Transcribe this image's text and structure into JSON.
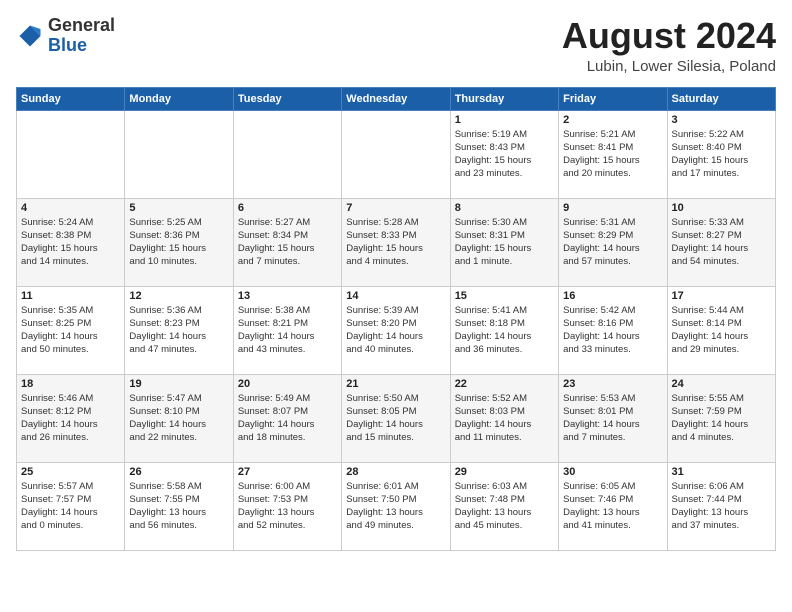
{
  "header": {
    "logo_general": "General",
    "logo_blue": "Blue",
    "month_title": "August 2024",
    "location": "Lubin, Lower Silesia, Poland"
  },
  "weekdays": [
    "Sunday",
    "Monday",
    "Tuesday",
    "Wednesday",
    "Thursday",
    "Friday",
    "Saturday"
  ],
  "weeks": [
    [
      {
        "day": "",
        "info": ""
      },
      {
        "day": "",
        "info": ""
      },
      {
        "day": "",
        "info": ""
      },
      {
        "day": "",
        "info": ""
      },
      {
        "day": "1",
        "info": "Sunrise: 5:19 AM\nSunset: 8:43 PM\nDaylight: 15 hours\nand 23 minutes."
      },
      {
        "day": "2",
        "info": "Sunrise: 5:21 AM\nSunset: 8:41 PM\nDaylight: 15 hours\nand 20 minutes."
      },
      {
        "day": "3",
        "info": "Sunrise: 5:22 AM\nSunset: 8:40 PM\nDaylight: 15 hours\nand 17 minutes."
      }
    ],
    [
      {
        "day": "4",
        "info": "Sunrise: 5:24 AM\nSunset: 8:38 PM\nDaylight: 15 hours\nand 14 minutes."
      },
      {
        "day": "5",
        "info": "Sunrise: 5:25 AM\nSunset: 8:36 PM\nDaylight: 15 hours\nand 10 minutes."
      },
      {
        "day": "6",
        "info": "Sunrise: 5:27 AM\nSunset: 8:34 PM\nDaylight: 15 hours\nand 7 minutes."
      },
      {
        "day": "7",
        "info": "Sunrise: 5:28 AM\nSunset: 8:33 PM\nDaylight: 15 hours\nand 4 minutes."
      },
      {
        "day": "8",
        "info": "Sunrise: 5:30 AM\nSunset: 8:31 PM\nDaylight: 15 hours\nand 1 minute."
      },
      {
        "day": "9",
        "info": "Sunrise: 5:31 AM\nSunset: 8:29 PM\nDaylight: 14 hours\nand 57 minutes."
      },
      {
        "day": "10",
        "info": "Sunrise: 5:33 AM\nSunset: 8:27 PM\nDaylight: 14 hours\nand 54 minutes."
      }
    ],
    [
      {
        "day": "11",
        "info": "Sunrise: 5:35 AM\nSunset: 8:25 PM\nDaylight: 14 hours\nand 50 minutes."
      },
      {
        "day": "12",
        "info": "Sunrise: 5:36 AM\nSunset: 8:23 PM\nDaylight: 14 hours\nand 47 minutes."
      },
      {
        "day": "13",
        "info": "Sunrise: 5:38 AM\nSunset: 8:21 PM\nDaylight: 14 hours\nand 43 minutes."
      },
      {
        "day": "14",
        "info": "Sunrise: 5:39 AM\nSunset: 8:20 PM\nDaylight: 14 hours\nand 40 minutes."
      },
      {
        "day": "15",
        "info": "Sunrise: 5:41 AM\nSunset: 8:18 PM\nDaylight: 14 hours\nand 36 minutes."
      },
      {
        "day": "16",
        "info": "Sunrise: 5:42 AM\nSunset: 8:16 PM\nDaylight: 14 hours\nand 33 minutes."
      },
      {
        "day": "17",
        "info": "Sunrise: 5:44 AM\nSunset: 8:14 PM\nDaylight: 14 hours\nand 29 minutes."
      }
    ],
    [
      {
        "day": "18",
        "info": "Sunrise: 5:46 AM\nSunset: 8:12 PM\nDaylight: 14 hours\nand 26 minutes."
      },
      {
        "day": "19",
        "info": "Sunrise: 5:47 AM\nSunset: 8:10 PM\nDaylight: 14 hours\nand 22 minutes."
      },
      {
        "day": "20",
        "info": "Sunrise: 5:49 AM\nSunset: 8:07 PM\nDaylight: 14 hours\nand 18 minutes."
      },
      {
        "day": "21",
        "info": "Sunrise: 5:50 AM\nSunset: 8:05 PM\nDaylight: 14 hours\nand 15 minutes."
      },
      {
        "day": "22",
        "info": "Sunrise: 5:52 AM\nSunset: 8:03 PM\nDaylight: 14 hours\nand 11 minutes."
      },
      {
        "day": "23",
        "info": "Sunrise: 5:53 AM\nSunset: 8:01 PM\nDaylight: 14 hours\nand 7 minutes."
      },
      {
        "day": "24",
        "info": "Sunrise: 5:55 AM\nSunset: 7:59 PM\nDaylight: 14 hours\nand 4 minutes."
      }
    ],
    [
      {
        "day": "25",
        "info": "Sunrise: 5:57 AM\nSunset: 7:57 PM\nDaylight: 14 hours\nand 0 minutes."
      },
      {
        "day": "26",
        "info": "Sunrise: 5:58 AM\nSunset: 7:55 PM\nDaylight: 13 hours\nand 56 minutes."
      },
      {
        "day": "27",
        "info": "Sunrise: 6:00 AM\nSunset: 7:53 PM\nDaylight: 13 hours\nand 52 minutes."
      },
      {
        "day": "28",
        "info": "Sunrise: 6:01 AM\nSunset: 7:50 PM\nDaylight: 13 hours\nand 49 minutes."
      },
      {
        "day": "29",
        "info": "Sunrise: 6:03 AM\nSunset: 7:48 PM\nDaylight: 13 hours\nand 45 minutes."
      },
      {
        "day": "30",
        "info": "Sunrise: 6:05 AM\nSunset: 7:46 PM\nDaylight: 13 hours\nand 41 minutes."
      },
      {
        "day": "31",
        "info": "Sunrise: 6:06 AM\nSunset: 7:44 PM\nDaylight: 13 hours\nand 37 minutes."
      }
    ]
  ]
}
